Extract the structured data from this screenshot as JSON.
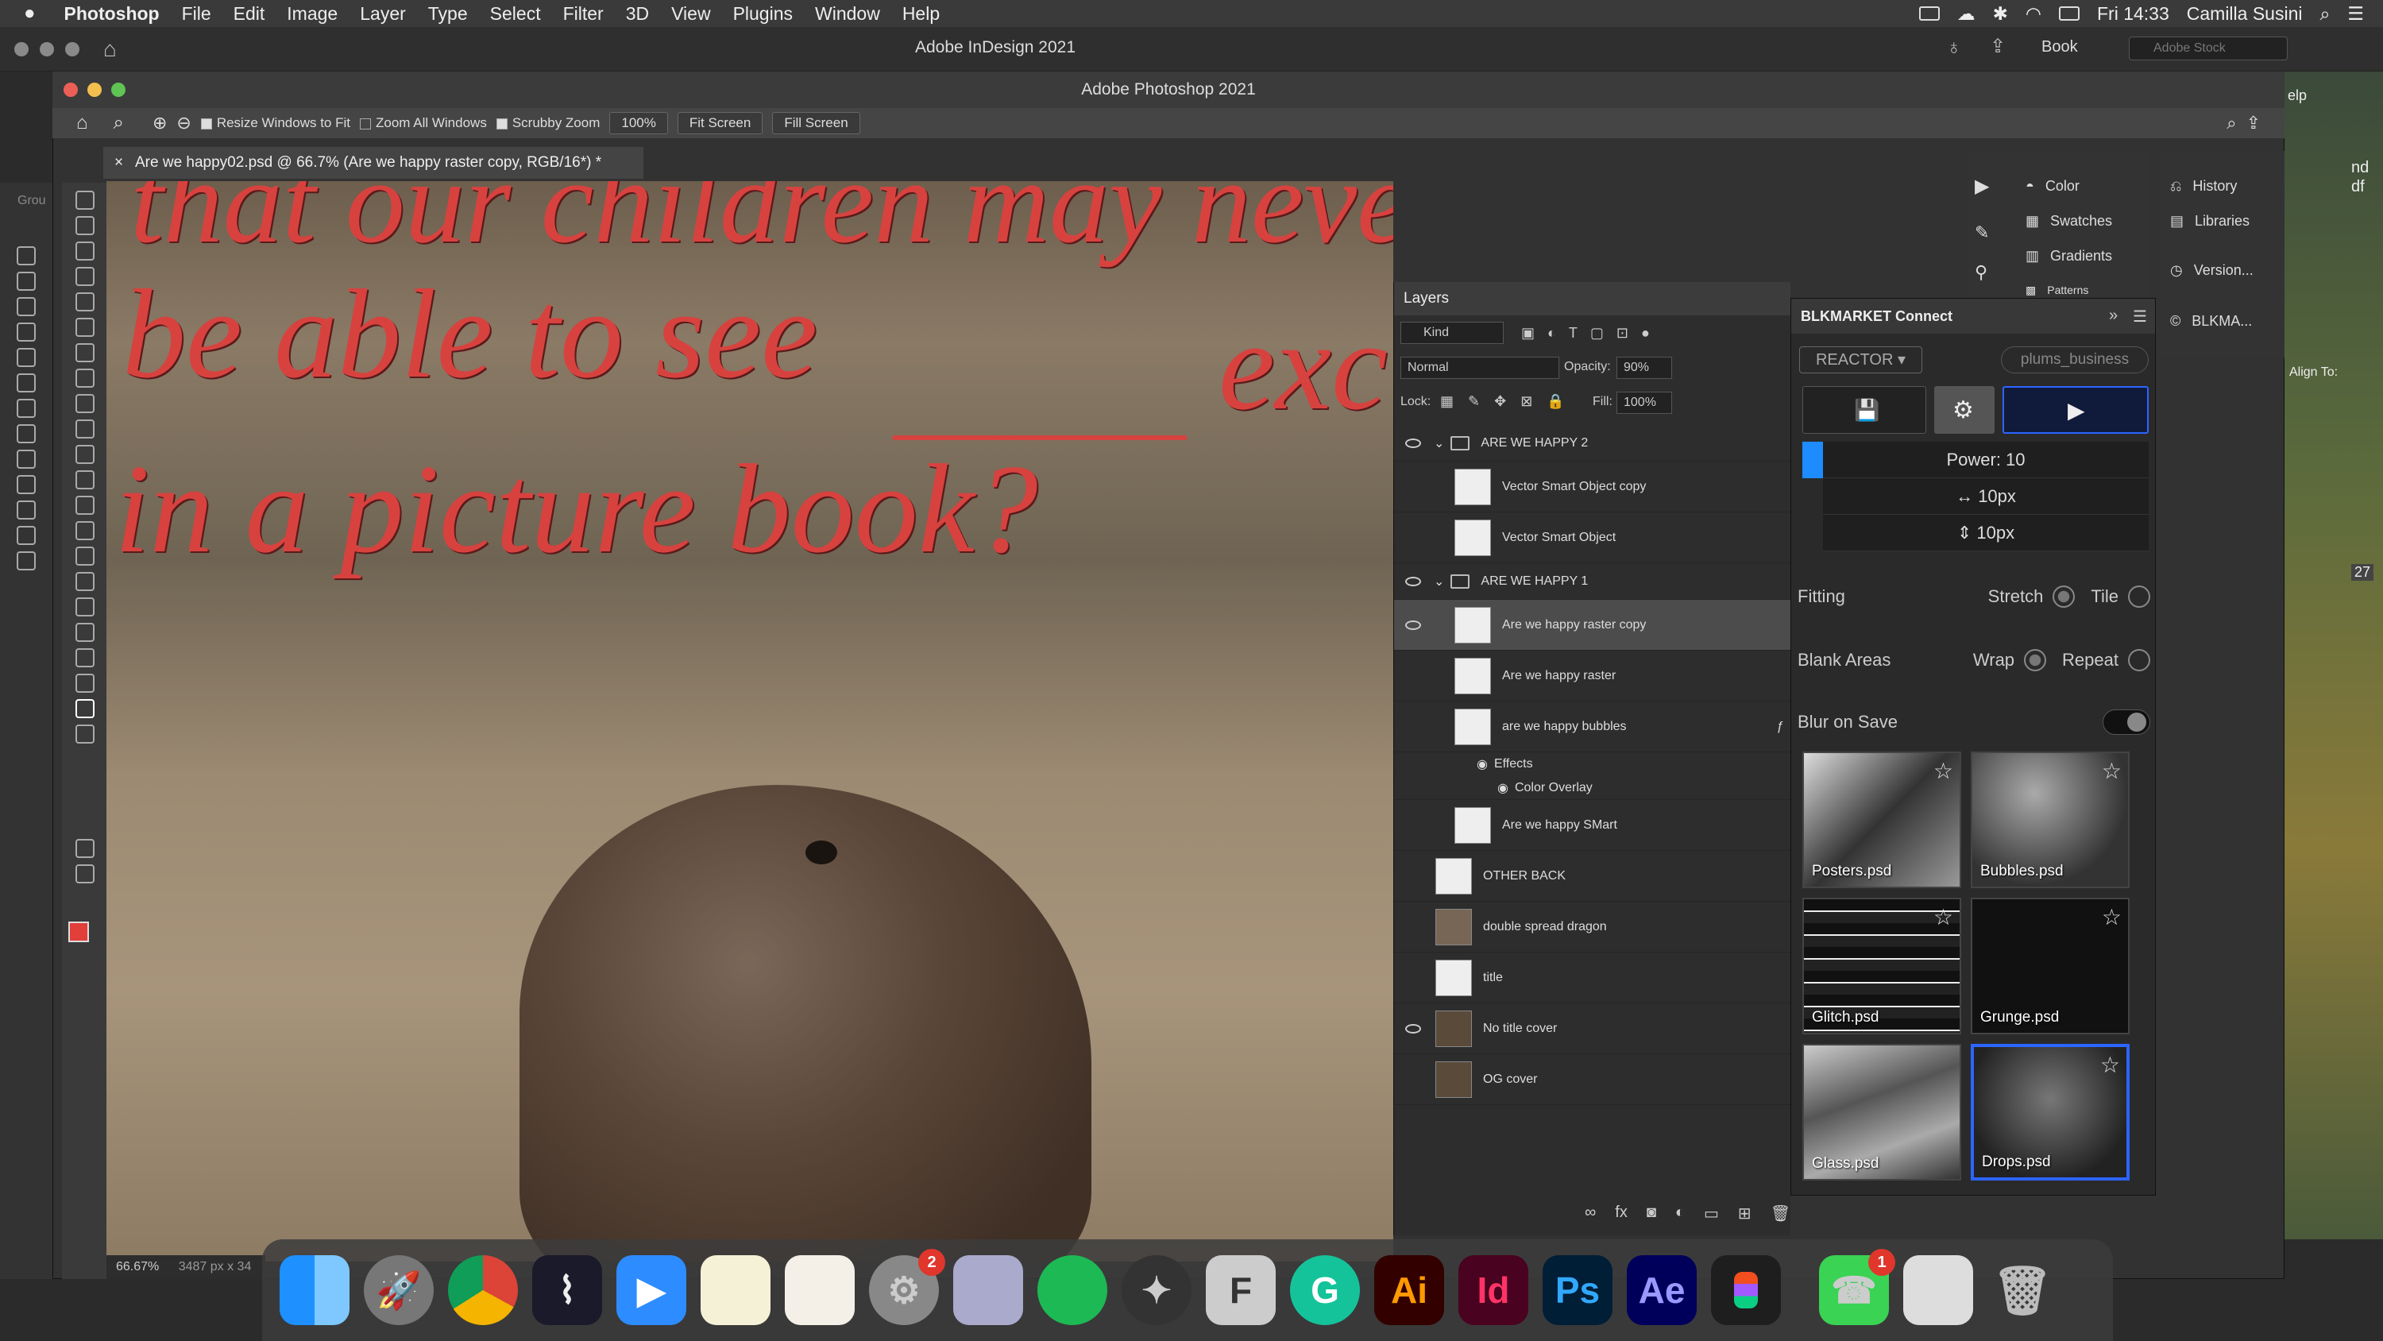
{
  "menubar": {
    "app": "Photoshop",
    "items": [
      "File",
      "Edit",
      "Image",
      "Layer",
      "Type",
      "Select",
      "Filter",
      "3D",
      "View",
      "Plugins",
      "Window",
      "Help"
    ],
    "clock": "Fri 14:33",
    "user": "Camilla Susini"
  },
  "indesign": {
    "title": "Adobe InDesign 2021",
    "book": "Book",
    "search_placeholder": "Adobe Stock"
  },
  "photoshop": {
    "title": "Adobe Photoshop 2021"
  },
  "options": {
    "resize": "Resize Windows to Fit",
    "zoom_all": "Zoom All Windows",
    "scrubby": "Scrubby Zoom",
    "zoom": "100%",
    "fit": "Fit Screen",
    "fill": "Fill Screen"
  },
  "doc_tab": "Are we happy02.psd @ 66.7% (Are we happy raster copy, RGB/16*) *",
  "canvas": {
    "line1": "that our children may never",
    "line2": "be able to see",
    "line2b": "exc",
    "line3": "in a picture book?"
  },
  "status": {
    "zoom": "66.67%",
    "size": "3487 px x 34"
  },
  "layers": {
    "tab": "Layers",
    "kind": "Kind",
    "blend": "Normal",
    "opacity_label": "Opacity:",
    "opacity": "90%",
    "lock_label": "Lock:",
    "fill_label": "Fill:",
    "fill": "100%",
    "rows": [
      "ARE WE HAPPY 2",
      "Vector Smart Object copy",
      "Vector Smart Object",
      "ARE WE HAPPY 1",
      "Are we happy raster copy",
      "Are we happy raster",
      "are we happy bubbles",
      "Effects",
      "Color Overlay",
      "Are we happy SMart",
      "OTHER BACK",
      "double spread dragon",
      "title",
      "No title cover",
      "OG cover"
    ]
  },
  "connect": {
    "title": "BLKMARKET Connect",
    "reactor": "REACTOR ▾",
    "account": "plums_business",
    "power": "Power: 10",
    "w": "↔ 10px",
    "h": "⇕ 10px",
    "fitting": "Fitting",
    "stretch": "Stretch",
    "tile": "Tile",
    "blank": "Blank Areas",
    "wrap": "Wrap",
    "repeat": "Repeat",
    "blur": "Blur on Save",
    "tiles": [
      "Posters.psd",
      "Bubbles.psd",
      "Glitch.psd",
      "Grunge.psd",
      "Glass.psd",
      "Drops.psd"
    ]
  },
  "panels": {
    "color": "Color",
    "swatches": "Swatches",
    "gradients": "Gradients",
    "patterns": "Patterns",
    "history": "History",
    "libraries": "Libraries",
    "version": "Version...",
    "blkma": "BLKMA..."
  },
  "side": {
    "align": "Align To:",
    "group": "Grou",
    "nd": "nd",
    "df": "df",
    "v27": "27",
    "help": "elp"
  },
  "dock": {
    "badge_settings": "2",
    "badge_facetime": "1",
    "ai": "Ai",
    "id": "Id",
    "ps": "Ps",
    "ae": "Ae",
    "f": "F"
  }
}
